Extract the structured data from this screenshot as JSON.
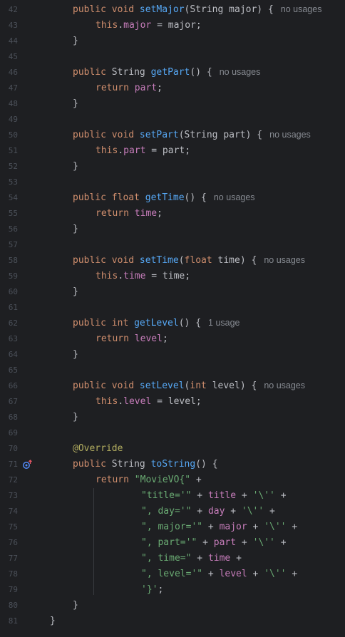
{
  "editor": {
    "lines": [
      {
        "num": "42",
        "indent": 1,
        "tokens": [
          {
            "t": "public void ",
            "c": "kw"
          },
          {
            "t": "setMajor",
            "c": "fn"
          },
          {
            "t": "(String major) {",
            "c": "txt"
          },
          {
            "t": "no usages",
            "c": "hint"
          }
        ]
      },
      {
        "num": "43",
        "indent": 2,
        "tokens": [
          {
            "t": "this",
            "c": "kw"
          },
          {
            "t": ".",
            "c": "txt"
          },
          {
            "t": "major",
            "c": "fld"
          },
          {
            "t": " = major;",
            "c": "txt"
          }
        ]
      },
      {
        "num": "44",
        "indent": 1,
        "tokens": [
          {
            "t": "}",
            "c": "txt"
          }
        ]
      },
      {
        "num": "45",
        "indent": 0,
        "tokens": []
      },
      {
        "num": "46",
        "indent": 1,
        "tokens": [
          {
            "t": "public ",
            "c": "kw"
          },
          {
            "t": "String ",
            "c": "txt"
          },
          {
            "t": "getPart",
            "c": "fn"
          },
          {
            "t": "() {",
            "c": "txt"
          },
          {
            "t": "no usages",
            "c": "hint"
          }
        ]
      },
      {
        "num": "47",
        "indent": 2,
        "tokens": [
          {
            "t": "return ",
            "c": "kw"
          },
          {
            "t": "part",
            "c": "fld"
          },
          {
            "t": ";",
            "c": "txt"
          }
        ]
      },
      {
        "num": "48",
        "indent": 1,
        "tokens": [
          {
            "t": "}",
            "c": "txt"
          }
        ]
      },
      {
        "num": "49",
        "indent": 0,
        "tokens": []
      },
      {
        "num": "50",
        "indent": 1,
        "tokens": [
          {
            "t": "public void ",
            "c": "kw"
          },
          {
            "t": "setPart",
            "c": "fn"
          },
          {
            "t": "(String part) {",
            "c": "txt"
          },
          {
            "t": "no usages",
            "c": "hint"
          }
        ]
      },
      {
        "num": "51",
        "indent": 2,
        "tokens": [
          {
            "t": "this",
            "c": "kw"
          },
          {
            "t": ".",
            "c": "txt"
          },
          {
            "t": "part",
            "c": "fld"
          },
          {
            "t": " = part;",
            "c": "txt"
          }
        ]
      },
      {
        "num": "52",
        "indent": 1,
        "tokens": [
          {
            "t": "}",
            "c": "txt"
          }
        ]
      },
      {
        "num": "53",
        "indent": 0,
        "tokens": []
      },
      {
        "num": "54",
        "indent": 1,
        "tokens": [
          {
            "t": "public float ",
            "c": "kw"
          },
          {
            "t": "getTime",
            "c": "fn"
          },
          {
            "t": "() {",
            "c": "txt"
          },
          {
            "t": "no usages",
            "c": "hint"
          }
        ]
      },
      {
        "num": "55",
        "indent": 2,
        "tokens": [
          {
            "t": "return ",
            "c": "kw"
          },
          {
            "t": "time",
            "c": "fld"
          },
          {
            "t": ";",
            "c": "txt"
          }
        ]
      },
      {
        "num": "56",
        "indent": 1,
        "tokens": [
          {
            "t": "}",
            "c": "txt"
          }
        ]
      },
      {
        "num": "57",
        "indent": 0,
        "tokens": []
      },
      {
        "num": "58",
        "indent": 1,
        "tokens": [
          {
            "t": "public void ",
            "c": "kw"
          },
          {
            "t": "setTime",
            "c": "fn"
          },
          {
            "t": "(",
            "c": "txt"
          },
          {
            "t": "float ",
            "c": "kw"
          },
          {
            "t": "time) {",
            "c": "txt"
          },
          {
            "t": "no usages",
            "c": "hint"
          }
        ]
      },
      {
        "num": "59",
        "indent": 2,
        "tokens": [
          {
            "t": "this",
            "c": "kw"
          },
          {
            "t": ".",
            "c": "txt"
          },
          {
            "t": "time",
            "c": "fld"
          },
          {
            "t": " = time;",
            "c": "txt"
          }
        ]
      },
      {
        "num": "60",
        "indent": 1,
        "tokens": [
          {
            "t": "}",
            "c": "txt"
          }
        ]
      },
      {
        "num": "61",
        "indent": 0,
        "tokens": []
      },
      {
        "num": "62",
        "indent": 1,
        "tokens": [
          {
            "t": "public int ",
            "c": "kw"
          },
          {
            "t": "getLevel",
            "c": "fn"
          },
          {
            "t": "() {",
            "c": "txt"
          },
          {
            "t": "1 usage",
            "c": "hint"
          }
        ]
      },
      {
        "num": "63",
        "indent": 2,
        "tokens": [
          {
            "t": "return ",
            "c": "kw"
          },
          {
            "t": "level",
            "c": "fld"
          },
          {
            "t": ";",
            "c": "txt"
          }
        ]
      },
      {
        "num": "64",
        "indent": 1,
        "tokens": [
          {
            "t": "}",
            "c": "txt"
          }
        ]
      },
      {
        "num": "65",
        "indent": 0,
        "tokens": []
      },
      {
        "num": "66",
        "indent": 1,
        "tokens": [
          {
            "t": "public void ",
            "c": "kw"
          },
          {
            "t": "setLevel",
            "c": "fn"
          },
          {
            "t": "(",
            "c": "txt"
          },
          {
            "t": "int ",
            "c": "kw"
          },
          {
            "t": "level) {",
            "c": "txt"
          },
          {
            "t": "no usages",
            "c": "hint"
          }
        ]
      },
      {
        "num": "67",
        "indent": 2,
        "tokens": [
          {
            "t": "this",
            "c": "kw"
          },
          {
            "t": ".",
            "c": "txt"
          },
          {
            "t": "level",
            "c": "fld"
          },
          {
            "t": " = level;",
            "c": "txt"
          }
        ]
      },
      {
        "num": "68",
        "indent": 1,
        "tokens": [
          {
            "t": "}",
            "c": "txt"
          }
        ]
      },
      {
        "num": "69",
        "indent": 0,
        "tokens": []
      },
      {
        "num": "70",
        "indent": 1,
        "tokens": [
          {
            "t": "@Override",
            "c": "ann"
          }
        ]
      },
      {
        "num": "71",
        "indent": 1,
        "tokens": [
          {
            "t": "public ",
            "c": "kw"
          },
          {
            "t": "String ",
            "c": "txt"
          },
          {
            "t": "toString",
            "c": "fn"
          },
          {
            "t": "() {",
            "c": "txt"
          }
        ],
        "gutter_icon": "override-method-icon"
      },
      {
        "num": "72",
        "indent": 2,
        "tokens": [
          {
            "t": "return ",
            "c": "kw"
          },
          {
            "t": "\"MovieVO{\"",
            "c": "str"
          },
          {
            "t": " +",
            "c": "txt"
          }
        ]
      },
      {
        "num": "73",
        "indent": 4,
        "tokens": [
          {
            "t": "\"title='\"",
            "c": "str"
          },
          {
            "t": " + ",
            "c": "txt"
          },
          {
            "t": "title",
            "c": "fld"
          },
          {
            "t": " + ",
            "c": "txt"
          },
          {
            "t": "'\\''",
            "c": "str"
          },
          {
            "t": " +",
            "c": "txt"
          }
        ]
      },
      {
        "num": "74",
        "indent": 4,
        "tokens": [
          {
            "t": "\", day='\"",
            "c": "str"
          },
          {
            "t": " + ",
            "c": "txt"
          },
          {
            "t": "day",
            "c": "fld"
          },
          {
            "t": " + ",
            "c": "txt"
          },
          {
            "t": "'\\''",
            "c": "str"
          },
          {
            "t": " +",
            "c": "txt"
          }
        ]
      },
      {
        "num": "75",
        "indent": 4,
        "tokens": [
          {
            "t": "\", major='\"",
            "c": "str"
          },
          {
            "t": " + ",
            "c": "txt"
          },
          {
            "t": "major",
            "c": "fld"
          },
          {
            "t": " + ",
            "c": "txt"
          },
          {
            "t": "'\\''",
            "c": "str"
          },
          {
            "t": " +",
            "c": "txt"
          }
        ]
      },
      {
        "num": "76",
        "indent": 4,
        "tokens": [
          {
            "t": "\", part='\"",
            "c": "str"
          },
          {
            "t": " + ",
            "c": "txt"
          },
          {
            "t": "part",
            "c": "fld"
          },
          {
            "t": " + ",
            "c": "txt"
          },
          {
            "t": "'\\''",
            "c": "str"
          },
          {
            "t": " +",
            "c": "txt"
          }
        ]
      },
      {
        "num": "77",
        "indent": 4,
        "tokens": [
          {
            "t": "\", time=\"",
            "c": "str"
          },
          {
            "t": " + ",
            "c": "txt"
          },
          {
            "t": "time",
            "c": "fld"
          },
          {
            "t": " +",
            "c": "txt"
          }
        ]
      },
      {
        "num": "78",
        "indent": 4,
        "tokens": [
          {
            "t": "\", level='\"",
            "c": "str"
          },
          {
            "t": " + ",
            "c": "txt"
          },
          {
            "t": "level",
            "c": "fld"
          },
          {
            "t": " + ",
            "c": "txt"
          },
          {
            "t": "'\\''",
            "c": "str"
          },
          {
            "t": " +",
            "c": "txt"
          }
        ]
      },
      {
        "num": "79",
        "indent": 4,
        "tokens": [
          {
            "t": "'}'",
            "c": "str"
          },
          {
            "t": ";",
            "c": "txt"
          }
        ]
      },
      {
        "num": "80",
        "indent": 1,
        "tokens": [
          {
            "t": "}",
            "c": "txt"
          }
        ]
      },
      {
        "num": "81",
        "indent": 0,
        "tokens": [
          {
            "t": "}",
            "c": "txt"
          }
        ]
      }
    ]
  }
}
